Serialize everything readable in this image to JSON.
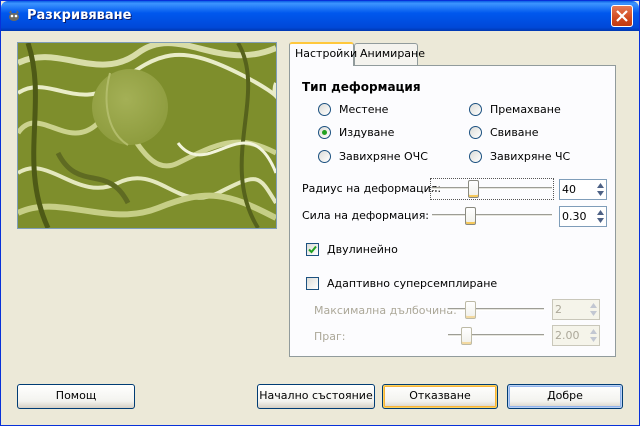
{
  "window": {
    "title": "Разкривяване"
  },
  "tabs": [
    {
      "label": "Настройки"
    },
    {
      "label": "Анимиране"
    }
  ],
  "deformation": {
    "title": "Тип деформация",
    "options": [
      {
        "label": "Местене",
        "selected": false
      },
      {
        "label": "Премахване",
        "selected": false
      },
      {
        "label": "Издуване",
        "selected": true
      },
      {
        "label": "Свиване",
        "selected": false
      },
      {
        "label": "Завихряне ОЧС",
        "selected": false
      },
      {
        "label": "Завихряне ЧС",
        "selected": false
      }
    ]
  },
  "radius": {
    "label": "Радиус на деформация:",
    "value": "40",
    "level": 0.33
  },
  "strength": {
    "label": "Сила на деформация:",
    "value": "0.30",
    "level": 0.3
  },
  "bilinear": {
    "label": "Двулинейно",
    "checked": true
  },
  "supersampling": {
    "label": "Адаптивно суперсемплиране",
    "checked": false
  },
  "max_depth": {
    "label": "Максимална дълбочина:",
    "value": "2",
    "level": 0.2
  },
  "threshold": {
    "label": "Праг:",
    "value": "2.00",
    "level": 0.15
  },
  "buttons": {
    "help": "Помощ",
    "reset": "Начално състояние",
    "cancel": "Отказване",
    "ok": "Добре"
  },
  "colors": {
    "title_bar": "#0054E3",
    "preview_tint": "#8A9A3A",
    "checkbox_mark": "#21A121"
  },
  "icons": {
    "app": "gimp-wilber-icon",
    "close": "close-icon"
  }
}
